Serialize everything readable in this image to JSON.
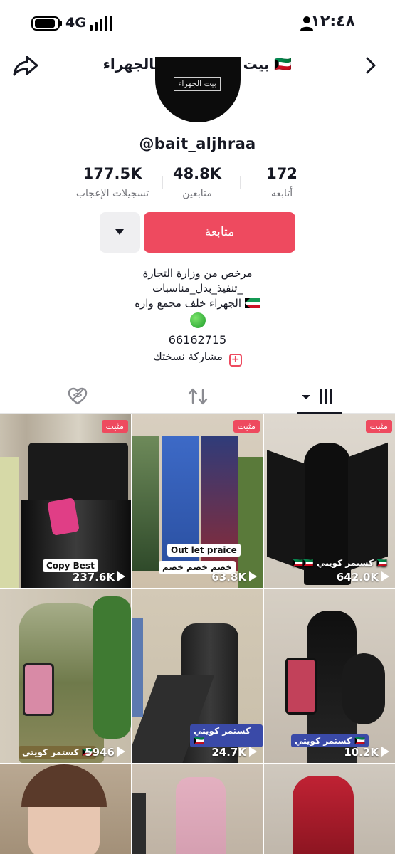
{
  "status_bar": {
    "time": "١٢:٤٨",
    "network": "4G"
  },
  "header": {
    "title": "بالجهراء 🇰🇼 بيت الجهراء 🇰🇼"
  },
  "profile": {
    "avatar_text": "بيت الجهراء",
    "username": "@bait_aljhraa",
    "stats": [
      {
        "value": "177.5K",
        "label": "تسجيلات الإعجاب"
      },
      {
        "value": "48.8K",
        "label": "متابعين"
      },
      {
        "value": "172",
        "label": "أتابعه"
      }
    ],
    "follow_label": "متابعة",
    "bio": {
      "line1": "مرخص من وزارة التجارة",
      "line2": "تنفيذ_بدل_مناسبات_",
      "line3": "الجهراء خلف مجمع واره",
      "phone": "66162715"
    },
    "share_label": "مشاركة نسختك"
  },
  "videos": [
    {
      "views": "237.6K",
      "pinned": "مثبت",
      "caption": "Copy Best",
      "colors": [
        "#3a3a3a",
        "#111111"
      ]
    },
    {
      "views": "63.8K",
      "pinned": "مثبت",
      "caption": "Out let praice",
      "caption2": "خصم خصم خصم",
      "colors": [
        "#2c5bb5",
        "#7a2a35"
      ]
    },
    {
      "views": "642.0K",
      "pinned": "مثبت",
      "caption": "🇰🇼🇰🇼 كستمر كويتي 🇰🇼",
      "colors": [
        "#111111",
        "#d9d4cd"
      ]
    },
    {
      "views": "5946",
      "caption": "كستمر كويتي 🇰🇼",
      "colors": [
        "#9fa67b",
        "#5b7a3d"
      ]
    },
    {
      "views": "24.7K",
      "caption": "كستمر كويتي 🇰🇼",
      "colors": [
        "#2a2a2a",
        "#d1c9b8"
      ]
    },
    {
      "views": "10.2K",
      "caption": "كستمر كويتي 🇰🇼",
      "colors": [
        "#1a1a1a",
        "#c9c1b5"
      ]
    },
    {
      "views": "",
      "colors": [
        "#c6a48c",
        "#6b4a3a"
      ]
    },
    {
      "views": "",
      "colors": [
        "#d9a8b8",
        "#b9a89a"
      ]
    },
    {
      "views": "",
      "colors": [
        "#b4202f",
        "#d8d0c8"
      ]
    }
  ]
}
